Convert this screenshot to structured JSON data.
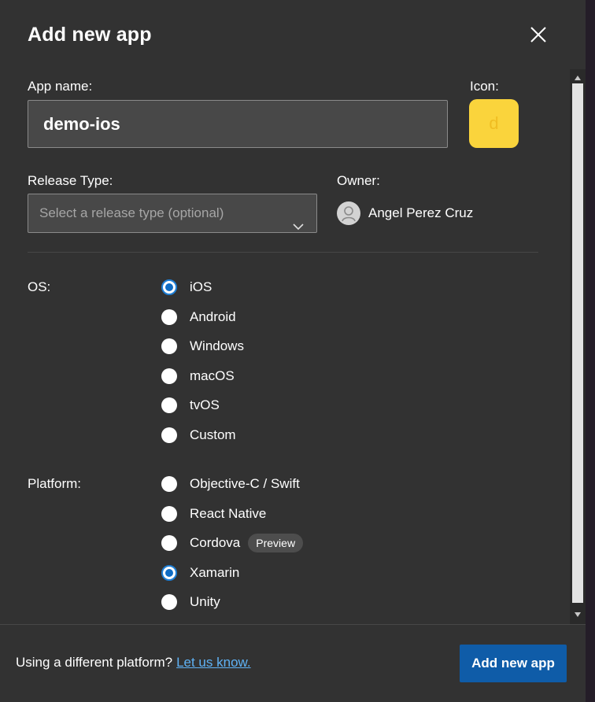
{
  "dialog": {
    "title": "Add new app",
    "close_icon": "close-icon"
  },
  "form": {
    "app_name_label": "App name:",
    "app_name_value": "demo-ios",
    "icon_label": "Icon:",
    "icon_letter": "d",
    "icon_color": "#fad43c",
    "release_type_label": "Release Type:",
    "release_type_placeholder": "Select a release type (optional)",
    "owner_label": "Owner:",
    "owner_name": "Angel Perez Cruz",
    "os_label": "OS:",
    "os_options": [
      {
        "label": "iOS",
        "checked": true
      },
      {
        "label": "Android",
        "checked": false
      },
      {
        "label": "Windows",
        "checked": false
      },
      {
        "label": "macOS",
        "checked": false
      },
      {
        "label": "tvOS",
        "checked": false
      },
      {
        "label": "Custom",
        "checked": false
      }
    ],
    "platform_label": "Platform:",
    "platform_options": [
      {
        "label": "Objective-C / Swift",
        "checked": false
      },
      {
        "label": "React Native",
        "checked": false
      },
      {
        "label": "Cordova",
        "checked": false,
        "badge": "Preview"
      },
      {
        "label": "Xamarin",
        "checked": true
      },
      {
        "label": "Unity",
        "checked": false
      }
    ]
  },
  "footer": {
    "prompt_text": "Using a different platform?",
    "link_text": "Let us know.",
    "submit_label": "Add new app"
  },
  "colors": {
    "panel_bg": "#323232",
    "accent": "#0f5ca8",
    "link": "#5fb2f5"
  }
}
